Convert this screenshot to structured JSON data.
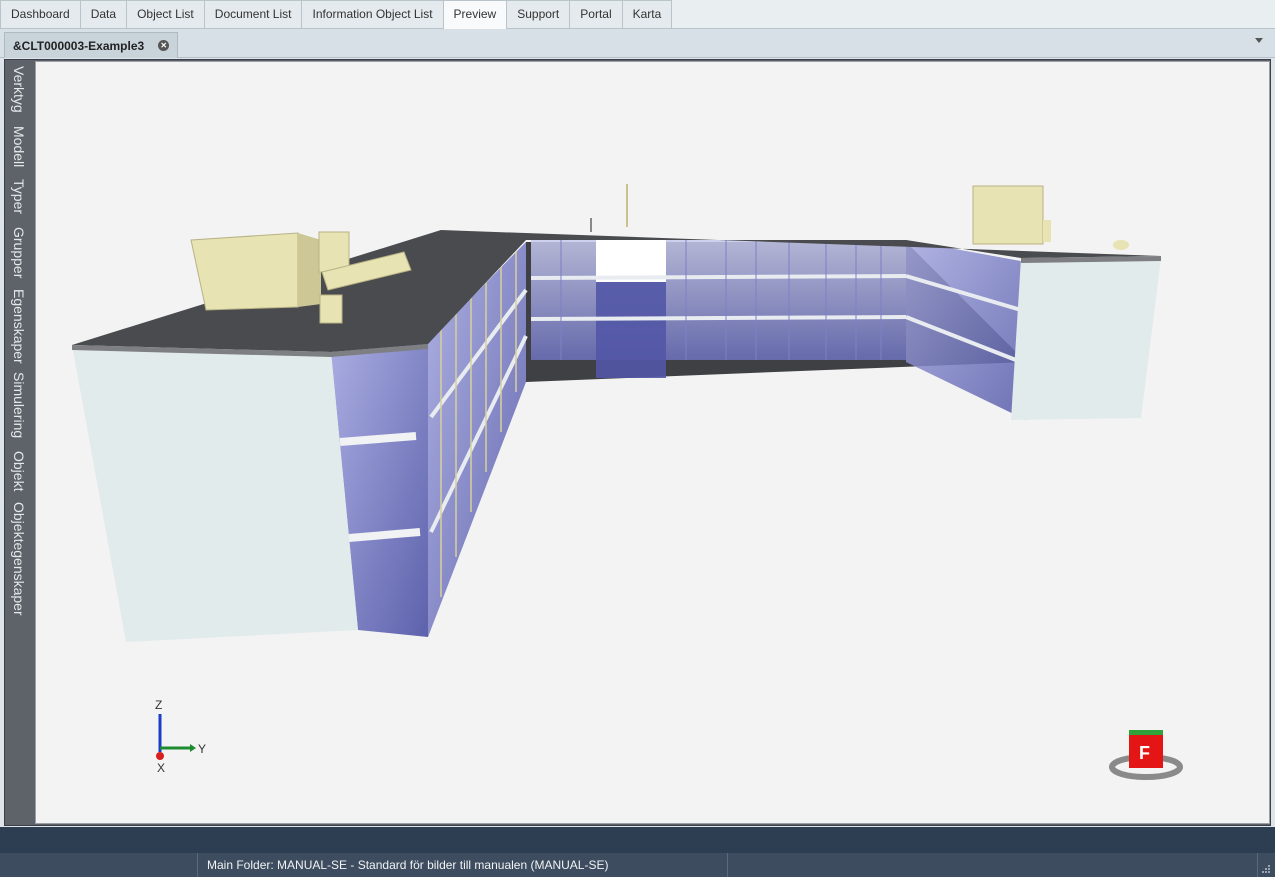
{
  "top_tabs": [
    {
      "label": "Dashboard"
    },
    {
      "label": "Data"
    },
    {
      "label": "Object List"
    },
    {
      "label": "Document List"
    },
    {
      "label": "Information Object List"
    },
    {
      "label": "Preview",
      "active": true
    },
    {
      "label": "Support"
    },
    {
      "label": "Portal"
    },
    {
      "label": "Karta"
    }
  ],
  "document_tab": {
    "label": "&CLT000003-Example3"
  },
  "side_panel": [
    {
      "label": "Verktyg"
    },
    {
      "label": "Modell"
    },
    {
      "label": "Typer"
    },
    {
      "label": "Grupper"
    },
    {
      "label": "Egenskaper"
    },
    {
      "label": "Simulering"
    },
    {
      "label": "Objekt"
    },
    {
      "label": "Objektegenskaper"
    }
  ],
  "axes": {
    "z": "Z",
    "y": "Y",
    "x": "X"
  },
  "nav_cube": {
    "face": "F"
  },
  "status": {
    "text": "Main Folder: MANUAL-SE - Standard för bilder till manualen (MANUAL-SE)"
  },
  "colors": {
    "status_bg": "#3d4c5f",
    "strip": "#2d3e52",
    "glass": "#5a5fb0",
    "roof": "#4a4b4e",
    "wall": "#e2ebeb",
    "hvac": "#e8e3b3"
  }
}
